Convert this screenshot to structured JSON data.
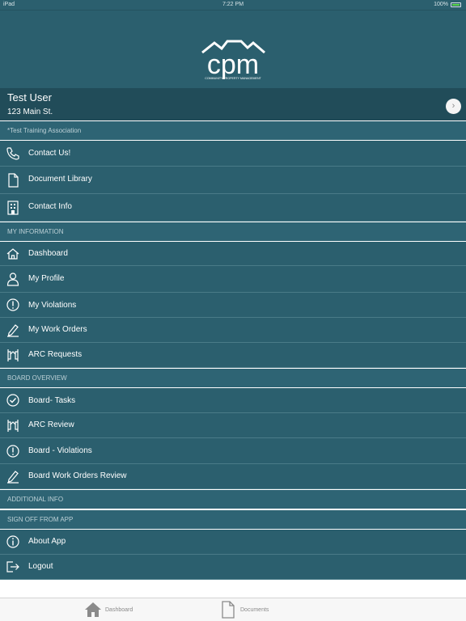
{
  "status_bar": {
    "carrier": "iPad",
    "time": "7:22 PM",
    "battery": "100%"
  },
  "brand": {
    "logo_text": "cpm",
    "logo_tagline": "COMMUNITY  PROPERTY  MANAGEMENT"
  },
  "user": {
    "name": "Test User",
    "address": "123 Main St."
  },
  "association": "*Test Training Association",
  "general_items": [
    {
      "label": "Contact Us!",
      "icon": "phone-icon"
    },
    {
      "label": "Document Library",
      "icon": "document-icon"
    },
    {
      "label": "Contact Info",
      "icon": "building-icon"
    }
  ],
  "sections": {
    "my_information": "MY INFORMATION",
    "board_overview": "BOARD OVERVIEW",
    "additional_info": "ADDITIONAL INFO",
    "sign_off": "SIGN OFF FROM APP"
  },
  "my_information_items": [
    {
      "label": "Dashboard",
      "icon": "home-icon"
    },
    {
      "label": "My Profile",
      "icon": "person-icon"
    },
    {
      "label": "My Violations",
      "icon": "alert-icon"
    },
    {
      "label": "My Work Orders",
      "icon": "pen-icon"
    },
    {
      "label": "ARC Requests",
      "icon": "arc-icon"
    }
  ],
  "board_items": [
    {
      "label": "Board- Tasks",
      "icon": "check-circle-icon"
    },
    {
      "label": "ARC Review",
      "icon": "arc-icon"
    },
    {
      "label": "Board - Violations",
      "icon": "alert-icon"
    },
    {
      "label": "Board Work Orders Review",
      "icon": "pen-icon"
    }
  ],
  "sign_off_items": [
    {
      "label": "About App",
      "icon": "info-icon"
    },
    {
      "label": "Logout",
      "icon": "logout-icon"
    }
  ],
  "tab_bar": {
    "dashboard": "Dashboard",
    "documents": "Documents",
    "more_icon": "more-dots-icon"
  },
  "colors": {
    "primary": "#2b5f6e",
    "user_bar": "#214c59",
    "tab_accent": "#2f7cf6"
  }
}
